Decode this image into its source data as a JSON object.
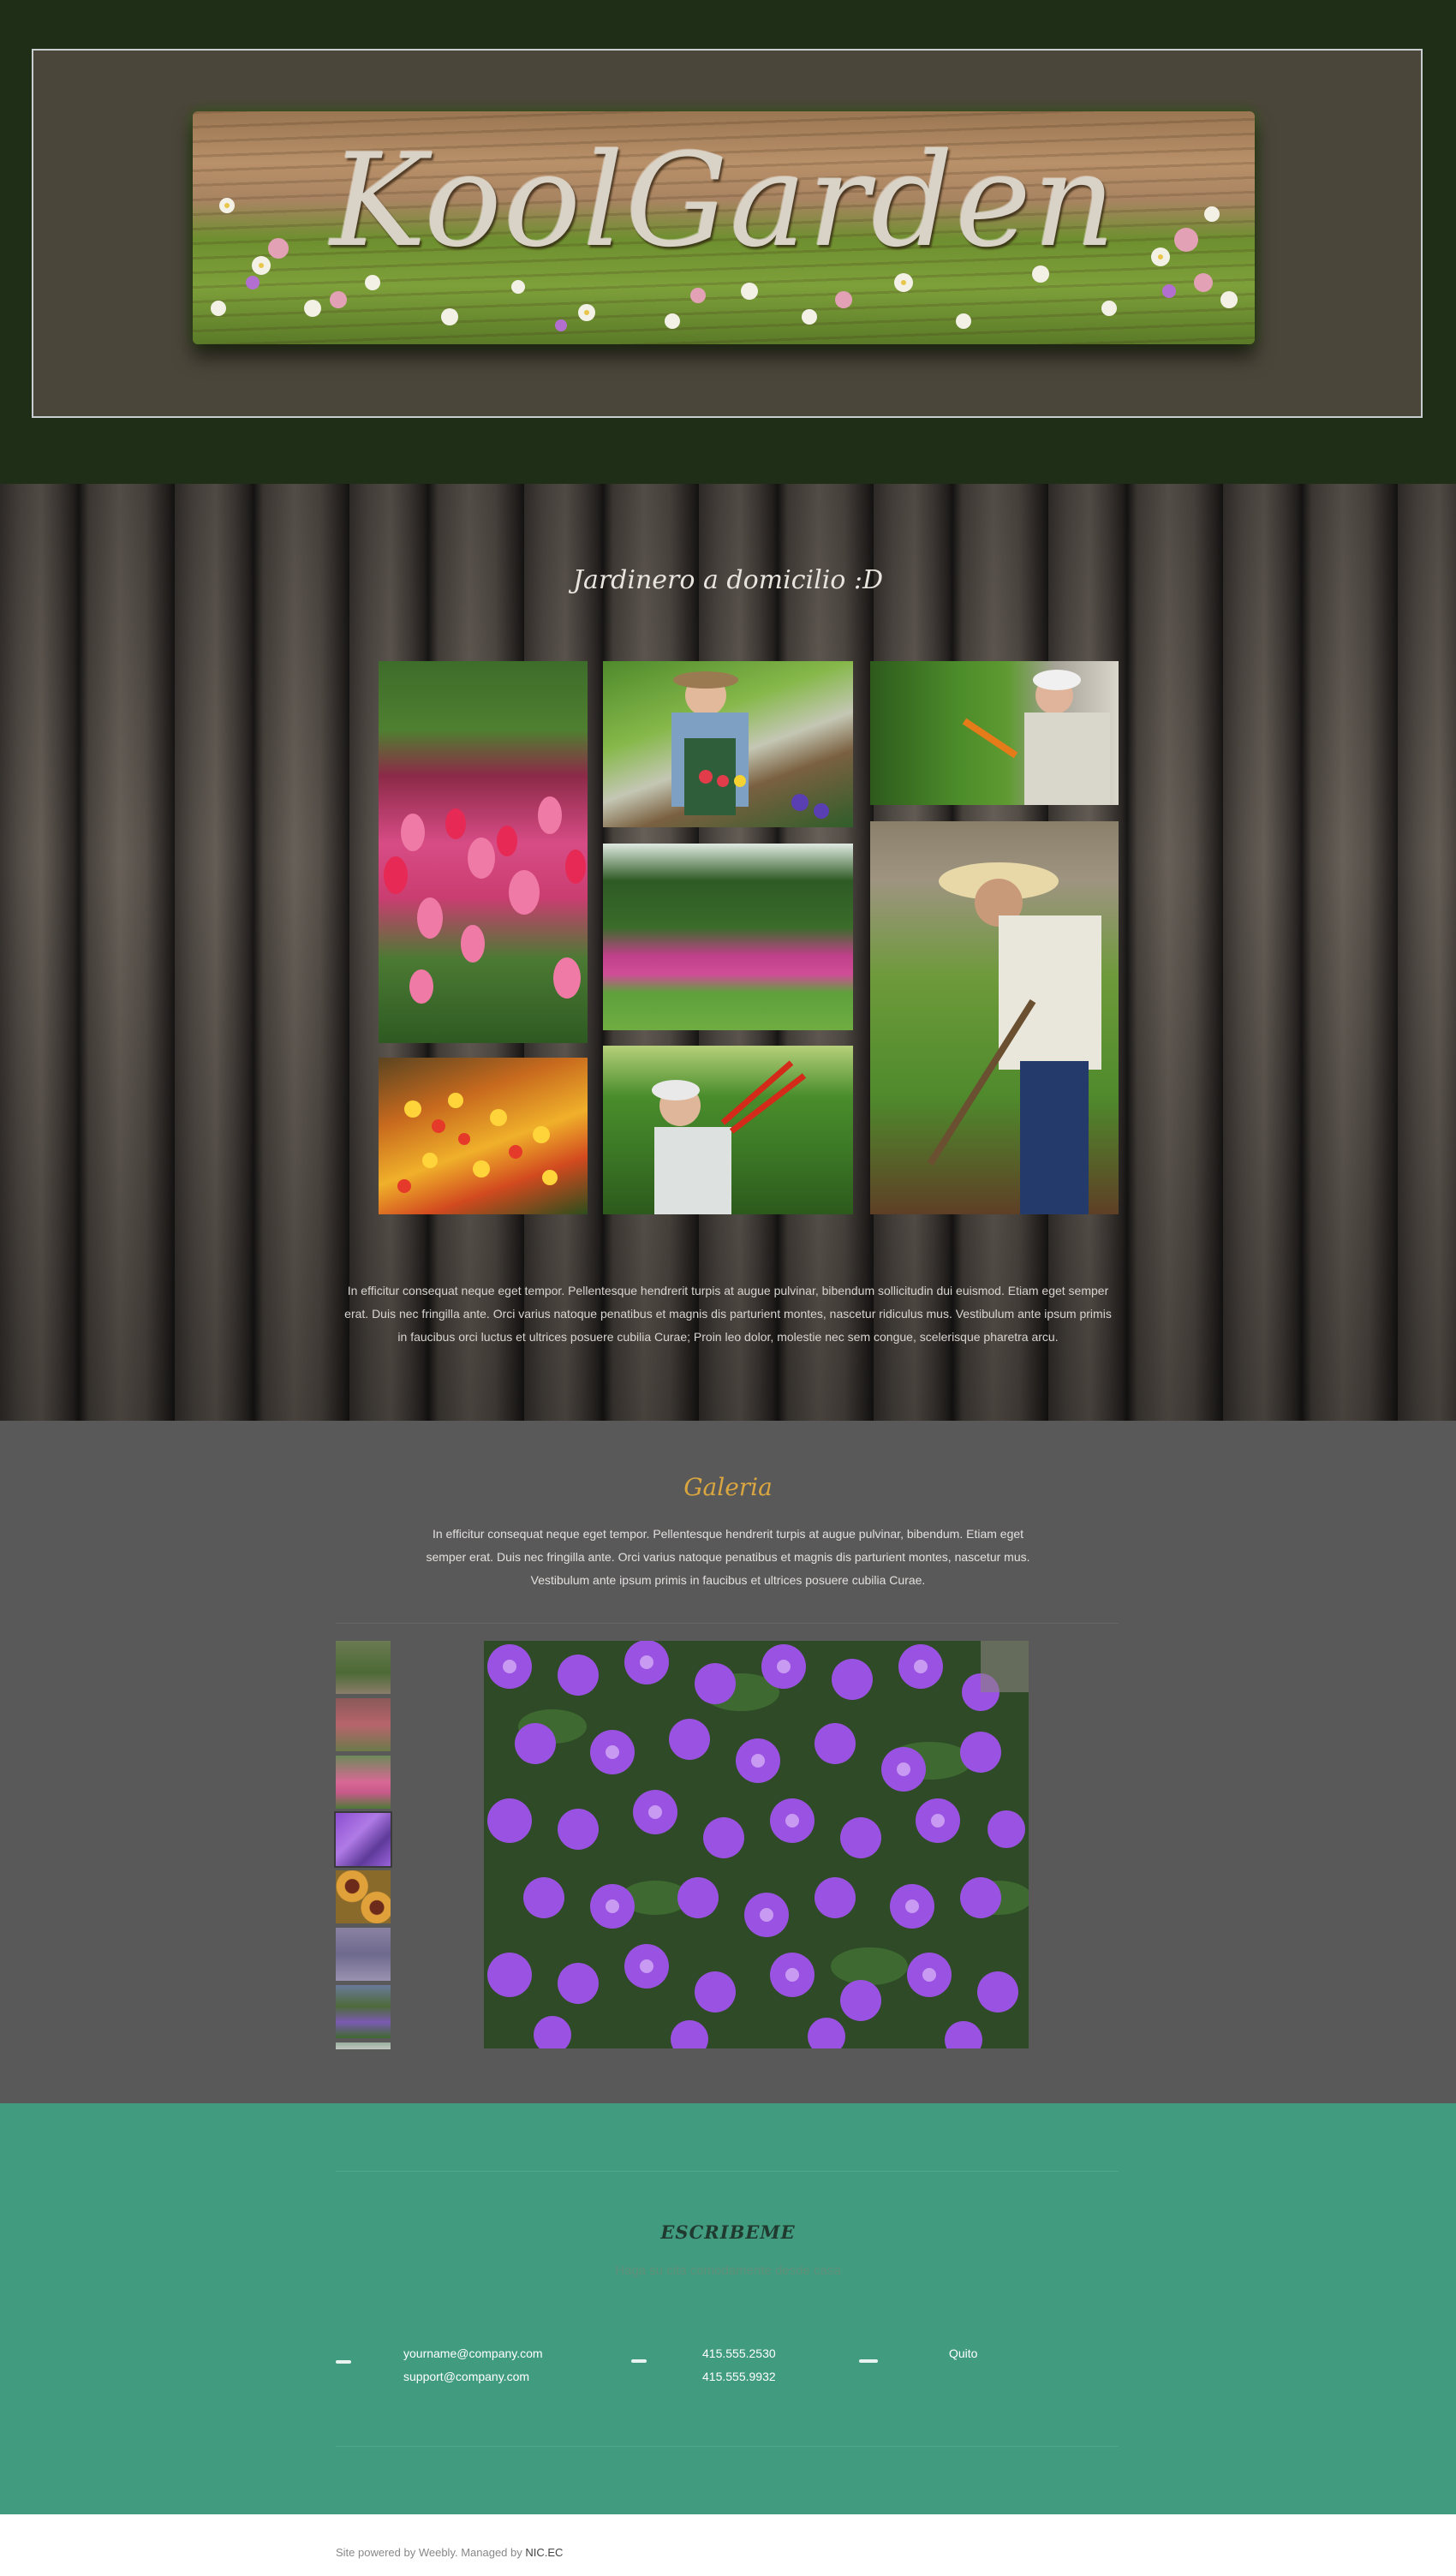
{
  "header": {
    "logo_text": "KoolGarden"
  },
  "hero": {
    "title": "Jardinero a domicilio :D",
    "body": "In efficitur consequat neque eget tempor. Pellentesque hendrerit turpis at augue pulvinar, bibendum sollicitudin dui euismod. Etiam eget semper erat. Duis nec fringilla ante. Orci varius natoque penatibus et magnis dis parturient montes, nascetur ridiculus mus. Vestibulum ante ipsum primis in faucibus orci luctus et ultrices posuere cubilia Curae; Proin leo dolor, molestie nec sem congue, scelerisque pharetra arcu."
  },
  "gallery": {
    "title": "Galeria",
    "body": "In efficitur consequat neque eget tempor. Pellentesque hendrerit turpis at augue pulvinar, bibendum. Etiam eget semper erat. Duis nec fringilla ante. Orci varius natoque penatibus et magnis dis parturient montes, nascetur  mus. Vestibulum ante ipsum primis in faucibus et ultrices posuere cubilia Curae."
  },
  "contact": {
    "title": "ESCRIBEME",
    "subtitle": "Haga su cita comodamente desde casa",
    "email_1": "yourname@company.com",
    "email_2": "support@company.com",
    "phone_1": "415.555.2530",
    "phone_2": "415.555.9932",
    "location": "Quito"
  },
  "footer": {
    "text": "Site powered by Weebly. Managed by ",
    "link": "NIC.EC"
  },
  "colors": {
    "header_bg": "#1f2e16",
    "gallery_bg": "#5a5959",
    "gallery_title": "#d9a640",
    "contact_bg": "#419b7f"
  }
}
